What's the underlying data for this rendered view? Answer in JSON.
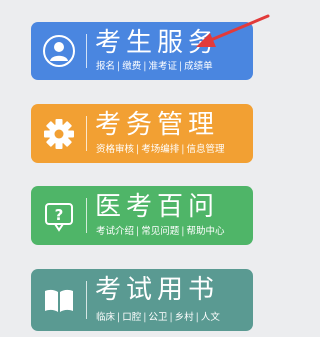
{
  "cards": [
    {
      "id": "kaosheng",
      "title": "考生服务",
      "icon": "user-icon",
      "color": "#4a86e0",
      "links": [
        "报名",
        "缴费",
        "准考证",
        "成绩单"
      ]
    },
    {
      "id": "kaowu",
      "title": "考务管理",
      "icon": "gear-icon",
      "color": "#f2a033",
      "links": [
        "资格审核",
        "考场编排",
        "信息管理"
      ]
    },
    {
      "id": "yikao",
      "title": "医考百问",
      "icon": "question-bubble-icon",
      "color": "#4fb568",
      "links": [
        "考试介绍",
        "常见问题",
        "帮助中心"
      ]
    },
    {
      "id": "shu",
      "title": "考试用书",
      "icon": "book-icon",
      "color": "#5a9a92",
      "links": [
        "临床",
        "口腔",
        "公卫",
        "乡村",
        "人文"
      ]
    }
  ],
  "separator": "|"
}
